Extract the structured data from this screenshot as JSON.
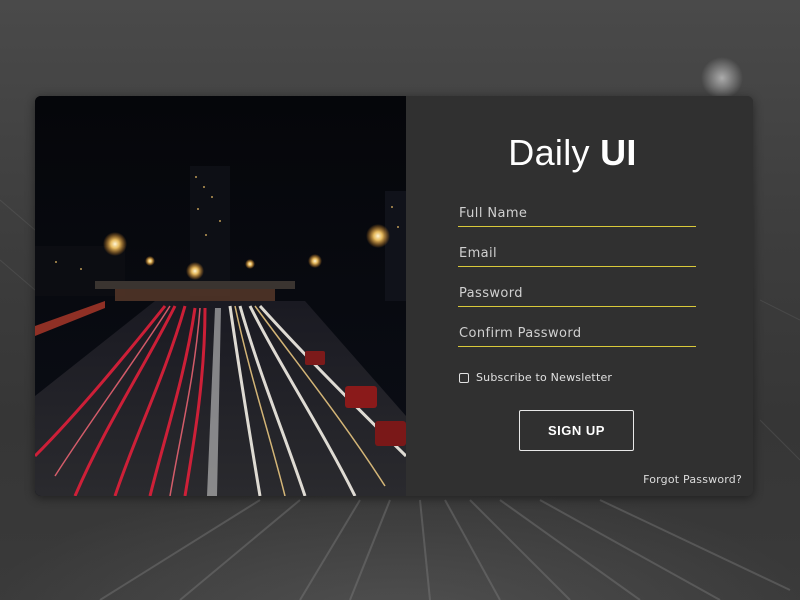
{
  "form": {
    "title_regular": "Daily ",
    "title_bold": "UI",
    "full_name_placeholder": "Full Name",
    "email_placeholder": "Email",
    "password_placeholder": "Password",
    "confirm_password_placeholder": "Confirm Password",
    "newsletter_label": "Subscribe to Newsletter",
    "signup_label": "SIGN UP",
    "forgot_label": "Forgot Password?"
  },
  "colors": {
    "accent_underline": "#d9c93a",
    "panel_bg": "#303030",
    "page_bg": "#3c3c3c"
  }
}
